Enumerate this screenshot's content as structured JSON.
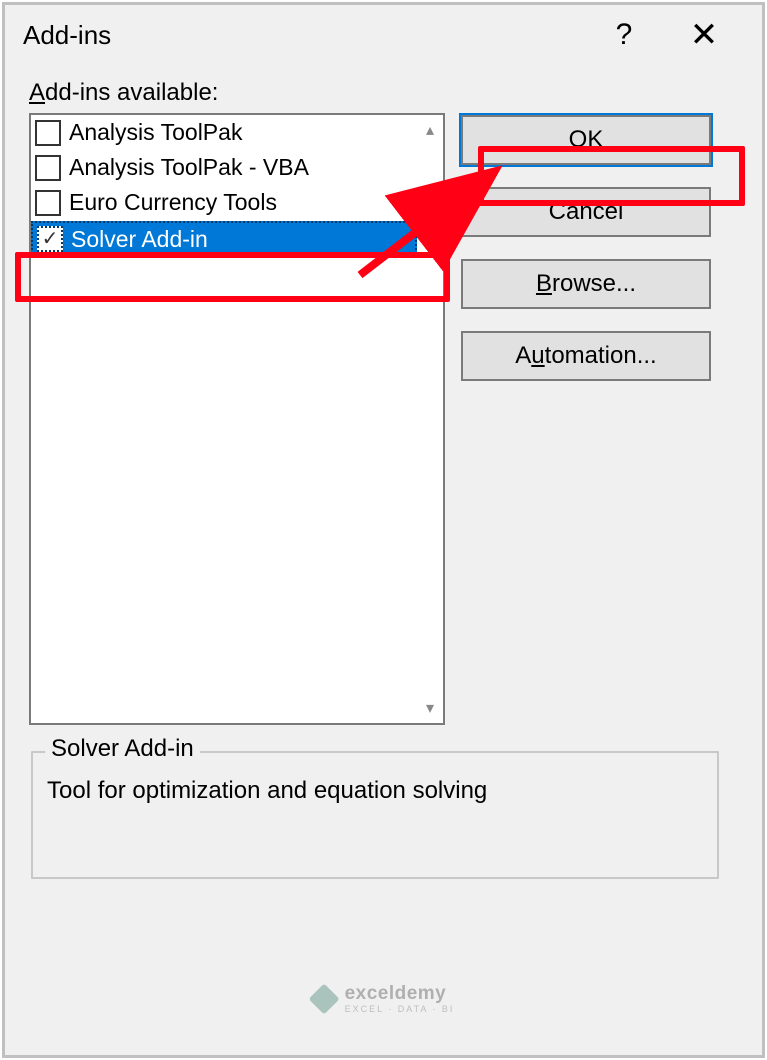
{
  "dialog": {
    "title": "Add-ins",
    "available_label_pre": "A",
    "available_label_post": "dd-ins available:"
  },
  "items": [
    {
      "label": "Analysis ToolPak",
      "checked": false,
      "selected": false
    },
    {
      "label": "Analysis ToolPak - VBA",
      "checked": false,
      "selected": false
    },
    {
      "label": "Euro Currency Tools",
      "checked": false,
      "selected": false
    },
    {
      "label": "Solver Add-in",
      "checked": true,
      "selected": true
    }
  ],
  "buttons": {
    "ok": "OK",
    "cancel": "Cancel",
    "browse_pre": "B",
    "browse_post": "rowse...",
    "automation_pre": "A",
    "automation_mid": "u",
    "automation_post": "tomation..."
  },
  "description": {
    "title": "Solver Add-in",
    "text": "Tool for optimization and equation solving"
  },
  "watermark": {
    "name": "exceldemy",
    "tagline": "EXCEL · DATA · BI"
  }
}
